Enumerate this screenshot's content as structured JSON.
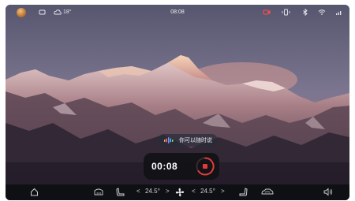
{
  "status_bar": {
    "temperature": "18°",
    "time": "08:08"
  },
  "voice_prompt": {
    "text": "你可以随时说"
  },
  "recording": {
    "elapsed": "00:08"
  },
  "dock": {
    "driver_temp": "24.5°",
    "passenger_temp": "24.5°"
  },
  "colors": {
    "accent_red": "#e23a3a",
    "status_red": "#ff4d4d"
  }
}
